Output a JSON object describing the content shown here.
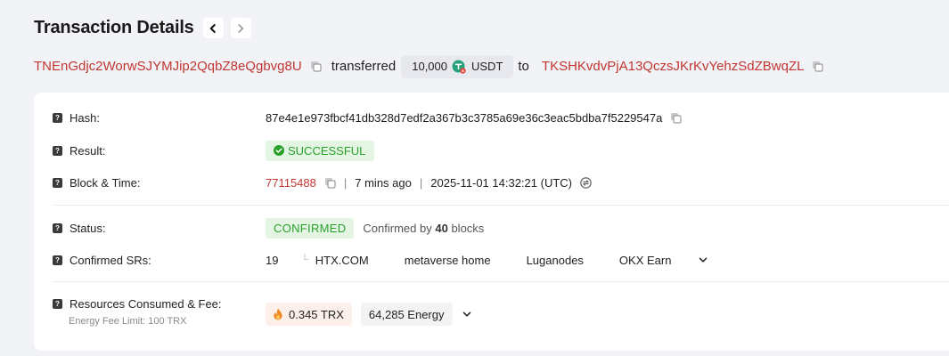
{
  "header": {
    "title": "Transaction Details",
    "prev_icon": "chevron-left-icon",
    "next_icon": "chevron-right-icon"
  },
  "transfer": {
    "from_address": "TNEnGdjc2WorwSJYMJip2QqbZ8eQgbvg8U",
    "action_text": "transferred",
    "amount": "10,000",
    "token": "USDT",
    "to_text": "to",
    "to_address": "TKSHKvdvPjA13QczsJKrKvYehzSdZBwqZL"
  },
  "details": {
    "hash": {
      "label": "Hash:",
      "value": "87e4e1e973fbcf41db328d7edf2a367b3c3785a69e36c3eac5bdba7f5229547a"
    },
    "result": {
      "label": "Result:",
      "value": "SUCCESSFUL"
    },
    "block_time": {
      "label": "Block & Time:",
      "block": "77115488",
      "separator": "|",
      "ago": "7 mins ago",
      "datetime": "2025-11-01 14:32:21 (UTC)"
    },
    "status": {
      "label": "Status:",
      "value": "CONFIRMED",
      "confirmed_prefix": "Confirmed by",
      "blocks_count": "40",
      "blocks_suffix": "blocks"
    },
    "confirmed_srs": {
      "label": "Confirmed SRs:",
      "count": "19",
      "mark": "└",
      "items": [
        "HTX.COM",
        "metaverse home",
        "Luganodes",
        "OKX Earn"
      ]
    },
    "resources": {
      "label": "Resources Consumed & Fee:",
      "sub_label": "Energy Fee Limit: 100 TRX",
      "fee": "0.345 TRX",
      "energy": "64,285 Energy"
    }
  },
  "colors": {
    "accent_red": "#c23631",
    "success_green": "#2aa02a",
    "success_bg": "#e4f5e4",
    "tether_green": "#26a17b",
    "fire_orange": "#f08a24"
  }
}
